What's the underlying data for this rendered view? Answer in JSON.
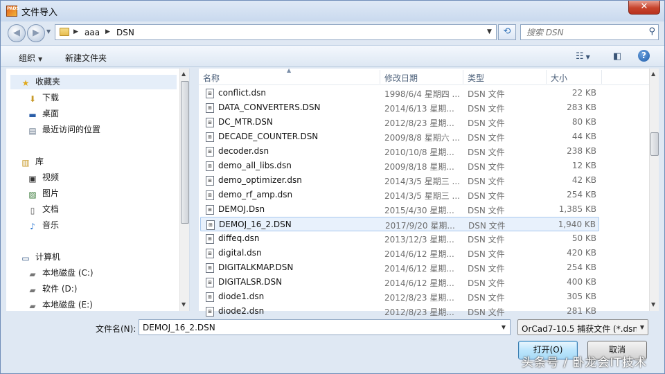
{
  "window": {
    "title": "文件导入",
    "app_icon_text": "PADS",
    "close_symbol": "✕"
  },
  "address": {
    "crumbs": [
      "aaa",
      "DSN"
    ],
    "search_placeholder": "搜索 DSN"
  },
  "toolbar": {
    "organize": "组织",
    "new_folder": "新建文件夹"
  },
  "nav": {
    "favorites": {
      "label": "收藏夹",
      "items": [
        "下载",
        "桌面",
        "最近访问的位置"
      ]
    },
    "libraries": {
      "label": "库",
      "items": [
        "视频",
        "图片",
        "文档",
        "音乐"
      ]
    },
    "computer": {
      "label": "计算机",
      "items": [
        "本地磁盘 (C:)",
        "软件 (D:)",
        "本地磁盘 (E:)"
      ]
    }
  },
  "columns": {
    "name": "名称",
    "date": "修改日期",
    "type": "类型",
    "size": "大小"
  },
  "files": [
    {
      "name": "conflict.dsn",
      "date": "1998/6/4 星期四 ...",
      "type": "DSN 文件",
      "size": "22 KB"
    },
    {
      "name": "DATA_CONVERTERS.DSN",
      "date": "2014/6/13 星期...",
      "type": "DSN 文件",
      "size": "283 KB"
    },
    {
      "name": "DC_MTR.DSN",
      "date": "2012/8/23 星期...",
      "type": "DSN 文件",
      "size": "80 KB"
    },
    {
      "name": "DECADE_COUNTER.DSN",
      "date": "2009/8/8 星期六 ...",
      "type": "DSN 文件",
      "size": "44 KB"
    },
    {
      "name": "decoder.dsn",
      "date": "2010/10/8 星期...",
      "type": "DSN 文件",
      "size": "238 KB"
    },
    {
      "name": "demo_all_libs.dsn",
      "date": "2009/8/18 星期...",
      "type": "DSN 文件",
      "size": "12 KB"
    },
    {
      "name": "demo_optimizer.dsn",
      "date": "2014/3/5 星期三 ...",
      "type": "DSN 文件",
      "size": "42 KB"
    },
    {
      "name": "demo_rf_amp.dsn",
      "date": "2014/3/5 星期三 ...",
      "type": "DSN 文件",
      "size": "254 KB"
    },
    {
      "name": "DEMOJ.Dsn",
      "date": "2015/4/30 星期...",
      "type": "DSN 文件",
      "size": "1,385 KB"
    },
    {
      "name": "DEMOJ_16_2.DSN",
      "date": "2017/9/20 星期...",
      "type": "DSN 文件",
      "size": "1,940 KB"
    },
    {
      "name": "diffeq.dsn",
      "date": "2013/12/3 星期...",
      "type": "DSN 文件",
      "size": "50 KB"
    },
    {
      "name": "digital.dsn",
      "date": "2014/6/12 星期...",
      "type": "DSN 文件",
      "size": "420 KB"
    },
    {
      "name": "DIGITALKMAP.DSN",
      "date": "2014/6/12 星期...",
      "type": "DSN 文件",
      "size": "254 KB"
    },
    {
      "name": "DIGITALSR.DSN",
      "date": "2014/6/12 星期...",
      "type": "DSN 文件",
      "size": "400 KB"
    },
    {
      "name": "diode1.dsn",
      "date": "2012/8/23 星期...",
      "type": "DSN 文件",
      "size": "305 KB"
    },
    {
      "name": "diode2.dsn",
      "date": "2012/8/23 星期...",
      "type": "DSN 文件",
      "size": "281 KB"
    }
  ],
  "selected_file_index": 9,
  "bottom": {
    "filename_label": "文件名(N):",
    "filename_value": "DEMOJ_16_2.DSN",
    "filter_value": "OrCad7-10.5 捕获文件 (*.dsn)",
    "open_button": "打开(O)",
    "cancel_button": "取消"
  },
  "watermark": "头条号 / 卧龙会IT技术",
  "colors": {
    "window_bg": "#dfe8f3",
    "selection": "#e8f1fc",
    "close_button": "#c7432c"
  }
}
